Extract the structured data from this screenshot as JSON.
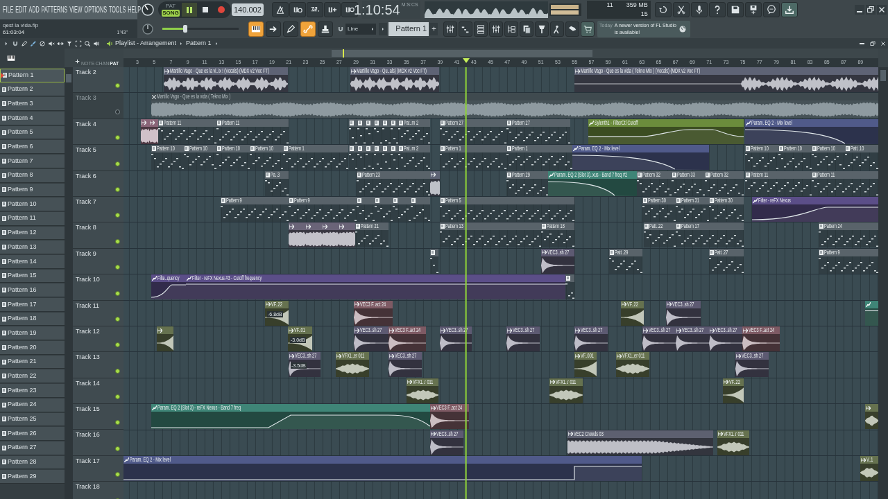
{
  "menu": [
    {
      "label": "FILE"
    },
    {
      "label": "EDIT"
    },
    {
      "label": "ADD"
    },
    {
      "label": "PATTERNS"
    },
    {
      "label": "VIEW"
    },
    {
      "label": "OPTIONS"
    },
    {
      "label": "TOOLS"
    },
    {
      "label": "HELP"
    }
  ],
  "transport": {
    "modes": [
      {
        "label": "PAT",
        "selected": false
      },
      {
        "label": "SONG",
        "selected": true
      }
    ],
    "playing": true,
    "tempo": "140.002",
    "time": "1:10:54",
    "time_format": "M:S:CS"
  },
  "monitor": {
    "polyphony": "11",
    "memory": "359 MB",
    "cpu": "15"
  },
  "project": {
    "file": "qest la vida.flp",
    "position": "61:03:04",
    "length": "1'43\""
  },
  "master_volume": {
    "level": 0.3
  },
  "snap_tools": [
    {
      "on": true
    },
    {
      "on": false
    },
    {
      "on": false
    },
    {
      "on": true
    },
    {
      "on": false
    }
  ],
  "snap": {
    "value": "Line"
  },
  "pattern_selector": {
    "value": "Pattern 1"
  },
  "news": {
    "when": "Today",
    "message": "A newer version of FL Studio is available!"
  },
  "playlist": {
    "title": "Playlist - Arrangement",
    "pattern": "Pattern 1",
    "header_tabs": [
      {
        "label": "NOTE",
        "selected": false
      },
      {
        "label": "CHAN",
        "selected": false
      },
      {
        "label": "PAT",
        "selected": true
      }
    ]
  },
  "ruler": [
    "3",
    "5",
    "7",
    "9",
    "11",
    "13",
    "15",
    "17",
    "19",
    "21",
    "23",
    "25",
    "27",
    "29",
    "31",
    "33",
    "35",
    "37",
    "39",
    "41",
    "43",
    "45",
    "47",
    "49",
    "51",
    "53",
    "55",
    "57",
    "59",
    "61",
    "63",
    "65",
    "67",
    "69",
    "71",
    "73",
    "75",
    "77",
    "79",
    "81",
    "83",
    "85",
    "87",
    "89"
  ],
  "patterns": [
    {
      "name": "Pattern 1",
      "selected": true
    },
    {
      "name": "Pattern 2",
      "selected": false
    },
    {
      "name": "Pattern 3",
      "selected": false
    },
    {
      "name": "Pattern 4",
      "selected": false
    },
    {
      "name": "Pattern 5",
      "selected": false
    },
    {
      "name": "Pattern 6",
      "selected": false
    },
    {
      "name": "Pattern 7",
      "selected": false
    },
    {
      "name": "Pattern 8",
      "selected": false
    },
    {
      "name": "Pattern 9",
      "selected": false
    },
    {
      "name": "Pattern 10",
      "selected": false
    },
    {
      "name": "Pattern 11",
      "selected": false
    },
    {
      "name": "Pattern 12",
      "selected": false
    },
    {
      "name": "Pattern 13",
      "selected": false
    },
    {
      "name": "Pattern 14",
      "selected": false
    },
    {
      "name": "Pattern 15",
      "selected": false
    },
    {
      "name": "Pattern 16",
      "selected": false
    },
    {
      "name": "Pattern 17",
      "selected": false
    },
    {
      "name": "Pattern 18",
      "selected": false
    },
    {
      "name": "Pattern 19",
      "selected": false
    },
    {
      "name": "Pattern 20",
      "selected": false
    },
    {
      "name": "Pattern 21",
      "selected": false
    },
    {
      "name": "Pattern 22",
      "selected": false
    },
    {
      "name": "Pattern 23",
      "selected": false
    },
    {
      "name": "Pattern 24",
      "selected": false
    },
    {
      "name": "Pattern 25",
      "selected": false
    },
    {
      "name": "Pattern 26",
      "selected": false
    },
    {
      "name": "Pattern 27",
      "selected": false
    },
    {
      "name": "Pattern 28",
      "selected": false
    },
    {
      "name": "Pattern 29",
      "selected": false
    }
  ],
  "tracks": [
    {
      "name": "Track 2",
      "enabled": true,
      "clips": [
        {
          "kind": "audio",
          "label": "Martillo Vago - Que es la vi..ix ! (Vocals) (MDX v2 Voc FT)",
          "color": "#5e6375",
          "muted": false
        },
        {
          "kind": "audio",
          "label": "Martillo Vago - Qu..als) (MDX v2 Voc FT)",
          "color": "#5e6375",
          "muted": false
        },
        {
          "kind": "audio",
          "label": "Martillo Vago - Que es la vida ( Tekno Mix ) (Vocals) (MDX v2 Voc FT)",
          "color": "#5e6375",
          "muted": false
        }
      ]
    },
    {
      "name": "Track 3",
      "enabled": false,
      "clips": [
        {
          "kind": "audio",
          "label": "Martillo Vago - Que es la vida ( Tekno Mix )",
          "color": "#3f4a4f",
          "muted": true
        }
      ]
    },
    {
      "name": "Track 4",
      "enabled": true,
      "clips": [
        {
          "kind": "audio",
          "color": "#8a6578",
          "muted": false
        },
        {
          "kind": "audio",
          "color": "#8a6578",
          "muted": false
        },
        {
          "kind": "pattern",
          "label": "Pattern 11",
          "color": "#59636a",
          "muted": false
        },
        {
          "kind": "pattern",
          "label": "Pattern 11",
          "color": "#59636a",
          "muted": false
        },
        {
          "kind": "pattern",
          "color": "#59636a",
          "muted": false
        },
        {
          "kind": "pattern",
          "color": "#59636a",
          "muted": false
        },
        {
          "kind": "pattern",
          "color": "#59636a",
          "muted": false
        },
        {
          "kind": "pattern",
          "color": "#59636a",
          "muted": false
        },
        {
          "kind": "pattern",
          "color": "#59636a",
          "muted": false
        },
        {
          "kind": "pattern",
          "color": "#59636a",
          "muted": false
        },
        {
          "kind": "pattern",
          "label": "Pat..rn 2",
          "color": "#59636a",
          "muted": false
        },
        {
          "kind": "pattern",
          "label": "Pattern 27",
          "color": "#59636a",
          "muted": false
        },
        {
          "kind": "pattern",
          "label": "Pattern 27",
          "color": "#59636a",
          "muted": false
        },
        {
          "kind": "automation",
          "label": "Sylenth1 - FilterCtl Cutoff",
          "color": "#6b8c3c",
          "muted": false
        },
        {
          "kind": "automation",
          "label": "Param. EQ 2 - Mix level",
          "color": "#505a8a",
          "muted": false
        }
      ]
    },
    {
      "name": "Track 5",
      "enabled": true,
      "clips": [
        {
          "kind": "pattern",
          "label": "Pattern 10",
          "color": "#59636a",
          "muted": false
        },
        {
          "kind": "pattern",
          "label": "Pattern 10",
          "color": "#59636a",
          "muted": false
        },
        {
          "kind": "pattern",
          "label": "Pattern 10",
          "color": "#59636a",
          "muted": false
        },
        {
          "kind": "pattern",
          "label": "Pattern 10",
          "color": "#59636a",
          "muted": false
        },
        {
          "kind": "pattern",
          "label": "Pattern 1",
          "color": "#59636a",
          "muted": false
        },
        {
          "kind": "pattern",
          "color": "#59636a",
          "muted": false
        },
        {
          "kind": "pattern",
          "color": "#59636a",
          "muted": false
        },
        {
          "kind": "pattern",
          "color": "#59636a",
          "muted": false
        },
        {
          "kind": "pattern",
          "color": "#59636a",
          "muted": false
        },
        {
          "kind": "pattern",
          "color": "#59636a",
          "muted": false
        },
        {
          "kind": "pattern",
          "color": "#59636a",
          "muted": false
        },
        {
          "kind": "pattern",
          "label": "Pat..rn 2",
          "color": "#59636a",
          "muted": false
        },
        {
          "kind": "pattern",
          "label": "Pattern 1",
          "color": "#59636a",
          "muted": false
        },
        {
          "kind": "pattern",
          "label": "Pattern 1",
          "color": "#59636a",
          "muted": false
        },
        {
          "kind": "automation",
          "label": "Param. EQ 2 - Mix level",
          "color": "#505a8a",
          "muted": false
        },
        {
          "kind": "pattern",
          "label": "Pattern 10",
          "color": "#59636a",
          "muted": false
        },
        {
          "kind": "pattern",
          "label": "Pattern 10",
          "color": "#59636a",
          "muted": false
        },
        {
          "kind": "pattern",
          "label": "Pattern 10",
          "color": "#59636a",
          "muted": false
        },
        {
          "kind": "pattern",
          "label": "Patt..10",
          "color": "#59636a",
          "muted": false
        }
      ]
    },
    {
      "name": "Track 6",
      "enabled": true,
      "clips": [
        {
          "kind": "pattern",
          "label": "Pa..3",
          "color": "#59636a",
          "muted": false
        },
        {
          "kind": "pattern",
          "label": "Pattern 23",
          "color": "#59636a",
          "muted": false
        },
        {
          "kind": "audio",
          "color": "#5e6375",
          "muted": false
        },
        {
          "kind": "pattern",
          "label": "Pattern 29",
          "color": "#59636a",
          "muted": false
        },
        {
          "kind": "automation",
          "label": "Param. EQ 2 (Slot 3)..xus - Band 7 freq #2",
          "color": "#3f8577",
          "muted": false
        },
        {
          "kind": "pattern",
          "label": "Pattern 32",
          "color": "#59636a",
          "muted": false
        },
        {
          "kind": "pattern",
          "label": "Pattern 33",
          "color": "#59636a",
          "muted": false
        },
        {
          "kind": "pattern",
          "label": "Pattern 32",
          "color": "#59636a",
          "muted": false
        },
        {
          "kind": "pattern",
          "label": "Pattern 11",
          "color": "#59636a",
          "muted": false
        },
        {
          "kind": "pattern",
          "label": "Pattern 11",
          "color": "#59636a",
          "muted": false
        }
      ]
    },
    {
      "name": "Track 7",
      "enabled": true,
      "clips": [
        {
          "kind": "pattern",
          "label": "Pattern 9",
          "color": "#59636a",
          "muted": false
        },
        {
          "kind": "pattern",
          "label": "Pattern 9",
          "color": "#59636a",
          "muted": false
        },
        {
          "kind": "pattern",
          "color": "#59636a",
          "muted": false
        },
        {
          "kind": "pattern",
          "color": "#59636a",
          "muted": false
        },
        {
          "kind": "pattern",
          "color": "#59636a",
          "muted": false
        },
        {
          "kind": "pattern",
          "color": "#59636a",
          "muted": false
        },
        {
          "kind": "pattern",
          "label": "Pattern 5",
          "color": "#59636a",
          "muted": false
        },
        {
          "kind": "pattern",
          "label": "Pattern 30",
          "color": "#59636a",
          "muted": false
        },
        {
          "kind": "pattern",
          "label": "Pattern 31",
          "color": "#59636a",
          "muted": false
        },
        {
          "kind": "pattern",
          "label": "Pattern 30",
          "color": "#59636a",
          "muted": false
        },
        {
          "kind": "automation",
          "label": "Filter - reFX Nexus",
          "color": "#5b4e88",
          "muted": false
        }
      ]
    },
    {
      "name": "Track 8",
      "enabled": true,
      "clips": [
        {
          "kind": "audio",
          "color": "#6a6478",
          "muted": false
        },
        {
          "kind": "audio",
          "color": "#6a6478",
          "muted": false
        },
        {
          "kind": "audio",
          "color": "#6a6478",
          "muted": false
        },
        {
          "kind": "audio",
          "color": "#6a6478",
          "muted": false
        },
        {
          "kind": "pattern",
          "label": "Pattern 21",
          "color": "#59636a",
          "muted": false
        },
        {
          "kind": "pattern",
          "label": "Pattern 13",
          "color": "#59636a",
          "muted": false
        },
        {
          "kind": "pattern",
          "label": "Pattern 18",
          "color": "#59636a",
          "muted": false
        },
        {
          "kind": "pattern",
          "label": "Patt..22",
          "color": "#59636a",
          "muted": false
        },
        {
          "kind": "pattern",
          "label": "Pattern 17",
          "color": "#59636a",
          "muted": false
        },
        {
          "kind": "pattern",
          "label": "Pattern 24",
          "color": "#59636a",
          "muted": false
        }
      ]
    },
    {
      "name": "Track 9",
      "enabled": true,
      "clips": [
        {
          "kind": "pattern",
          "color": "#59636a",
          "muted": false
        },
        {
          "kind": "audio",
          "label": "VEC3..sh 27",
          "color": "#5d5a72",
          "muted": false
        },
        {
          "kind": "pattern",
          "label": "Patt..29",
          "color": "#59636a",
          "muted": false
        },
        {
          "kind": "pattern",
          "label": "Patt..27",
          "color": "#59636a",
          "muted": false
        },
        {
          "kind": "pattern",
          "label": "Pattern 9",
          "color": "#59636a",
          "muted": false
        }
      ]
    },
    {
      "name": "Track 10",
      "enabled": true,
      "clips": [
        {
          "kind": "automation",
          "label": "Filte..quency",
          "color": "#5b4e88",
          "muted": false
        },
        {
          "kind": "automation",
          "label": "Filter - reFX Nexus #3 - Cutoff frequency",
          "color": "#5b4e88",
          "muted": false
        },
        {
          "kind": "pattern",
          "color": "#59636a",
          "muted": false
        }
      ]
    },
    {
      "name": "Track 11",
      "enabled": true,
      "clips": [
        {
          "kind": "audio",
          "label": "VF..22",
          "gain": "-6.8dB",
          "color": "#66724f",
          "muted": false
        },
        {
          "kind": "audio",
          "label": "VEC3 F..act 24",
          "color": "#7e5a64",
          "muted": false
        },
        {
          "kind": "audio",
          "label": "VF..22",
          "color": "#66724f",
          "muted": false
        },
        {
          "kind": "audio",
          "label": "VEC3..sh 27",
          "color": "#5d5a72",
          "muted": false
        },
        {
          "kind": "automation",
          "color": "#3f8577",
          "muted": false
        }
      ]
    },
    {
      "name": "Track 12",
      "enabled": true,
      "clips": [
        {
          "kind": "audio",
          "color": "#66724f",
          "muted": false
        },
        {
          "kind": "audio",
          "label": "VF..01",
          "gain": "-3.0dB",
          "color": "#66724f",
          "muted": false
        },
        {
          "kind": "audio",
          "label": "VEC3..sh 27",
          "color": "#5d5a72",
          "muted": false
        },
        {
          "kind": "audio",
          "label": "VEC3 F..act 24",
          "color": "#7e5a64",
          "muted": false
        },
        {
          "kind": "audio",
          "label": "VEC3..sh 27",
          "color": "#5d5a72",
          "muted": false
        },
        {
          "kind": "audio",
          "label": "VEC3..sh 27",
          "color": "#5d5a72",
          "muted": false
        },
        {
          "kind": "audio",
          "label": "VEC3..sh 27",
          "color": "#5d5a72",
          "muted": false
        },
        {
          "kind": "audio",
          "label": "VEC3..sh 27",
          "color": "#5d5a72",
          "muted": false
        },
        {
          "kind": "audio",
          "label": "VEC3..sh 27",
          "color": "#5d5a72",
          "muted": false
        },
        {
          "kind": "audio",
          "label": "VEC3..sh 27",
          "color": "#5d5a72",
          "muted": false
        },
        {
          "kind": "audio",
          "label": "VEC3 F..act 24",
          "color": "#7e5a64",
          "muted": false
        }
      ]
    },
    {
      "name": "Track 13",
      "enabled": true,
      "clips": [
        {
          "kind": "audio",
          "label": "VEC3..sh 27",
          "gain": "-3.5dB",
          "color": "#5d5a72",
          "muted": false
        },
        {
          "kind": "audio",
          "label": "VFX1..er 011",
          "color": "#66724f",
          "muted": false
        },
        {
          "kind": "audio",
          "label": "VEC3..sh 27",
          "color": "#5d5a72",
          "muted": false
        },
        {
          "kind": "audio",
          "label": "VF..001",
          "color": "#66724f",
          "muted": false
        },
        {
          "kind": "audio",
          "label": "VFX1..er 011",
          "color": "#66724f",
          "muted": false
        },
        {
          "kind": "audio",
          "label": "VEC3..sh 27",
          "color": "#5d5a72",
          "muted": false
        }
      ]
    },
    {
      "name": "Track 14",
      "enabled": true,
      "clips": [
        {
          "kind": "audio",
          "label": "VFX1..r 011",
          "color": "#66724f",
          "muted": false
        },
        {
          "kind": "audio",
          "label": "VFX1..r 011",
          "color": "#66724f",
          "muted": false
        },
        {
          "kind": "audio",
          "label": "VF..22",
          "color": "#66724f",
          "muted": false
        }
      ]
    },
    {
      "name": "Track 15",
      "enabled": true,
      "clips": [
        {
          "kind": "automation",
          "label": "Param. EQ 2 (Slot 3) - reFX Nexus - Band 7 freq",
          "color": "#3f8577",
          "muted": false
        },
        {
          "kind": "audio",
          "label": "VEC3 F..act 24",
          "color": "#7e5a64",
          "muted": false
        },
        {
          "kind": "audio",
          "color": "#66724f",
          "muted": false
        }
      ]
    },
    {
      "name": "Track 16",
      "enabled": true,
      "clips": [
        {
          "kind": "audio",
          "label": "VEC3..sh 27",
          "color": "#5d5a72",
          "muted": false
        },
        {
          "kind": "audio",
          "label": "VEC2 Crowds 03",
          "color": "#5d6070",
          "muted": false
        },
        {
          "kind": "audio",
          "label": "VFX1..r 011",
          "color": "#66724f",
          "muted": false
        }
      ]
    },
    {
      "name": "Track 17",
      "enabled": true,
      "clips": [
        {
          "kind": "automation",
          "label": "Param. EQ 2 - Mix level",
          "color": "#505a8a",
          "muted": false
        },
        {
          "kind": "audio",
          "label": "V..1",
          "color": "#66724f",
          "muted": false
        }
      ]
    },
    {
      "name": "Track 18",
      "enabled": true
    }
  ]
}
